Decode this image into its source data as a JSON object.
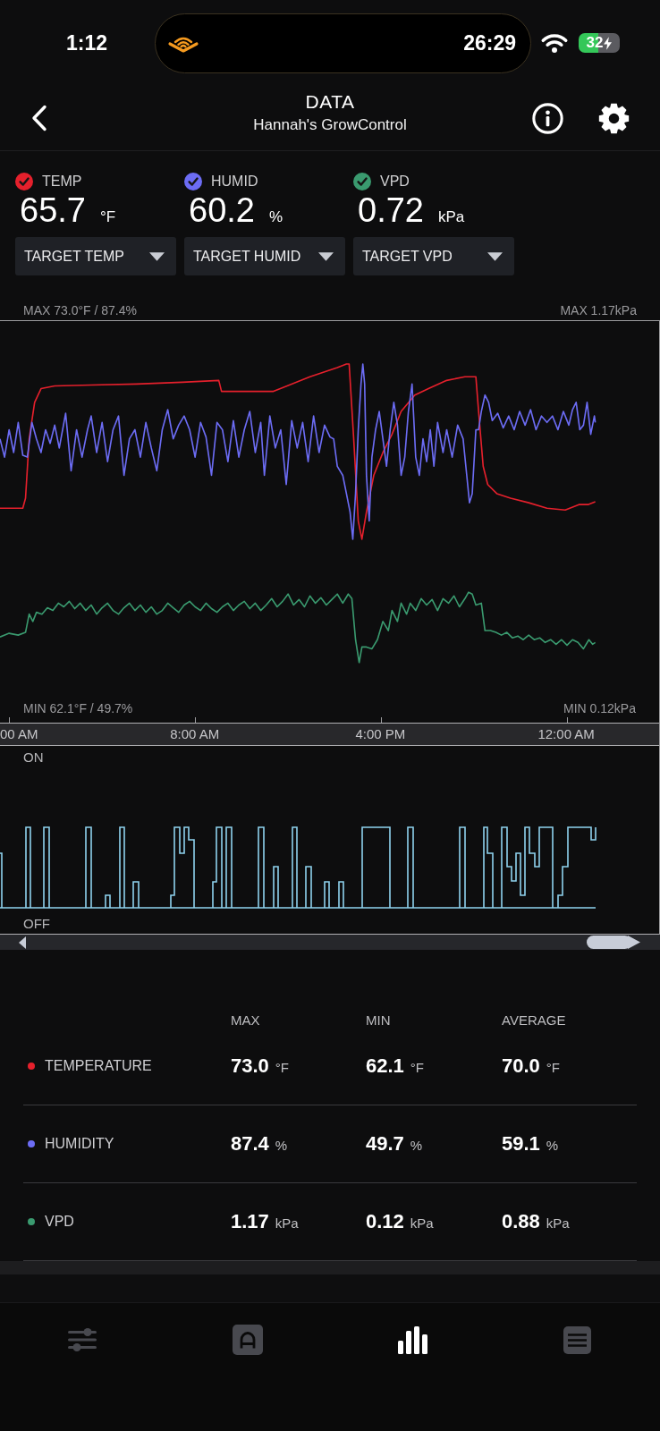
{
  "status_bar": {
    "time": "1:12",
    "timer": "26:29",
    "battery": "32"
  },
  "header": {
    "title": "DATA",
    "subtitle": "Hannah's GrowControl"
  },
  "readings": [
    {
      "label": "TEMP",
      "checked": true,
      "color": "#e5202c",
      "value": "65.7",
      "unit": "°F",
      "target": "TARGET TEMP"
    },
    {
      "label": "HUMID",
      "checked": true,
      "color": "#6c6cf4",
      "value": "60.2",
      "unit": "%",
      "target": "TARGET HUMID"
    },
    {
      "label": "VPD",
      "checked": true,
      "color": "#3a9a6f",
      "value": "0.72",
      "unit": "kPa",
      "target": "TARGET VPD"
    }
  ],
  "chart": {
    "max_left": "MAX 73.0°F / 87.4%",
    "max_right": "MAX 1.17kPa",
    "min_left": "MIN 62.1°F / 49.7%",
    "min_right": "MIN 0.12kPa",
    "time_labels": [
      "00 AM",
      "8:00 AM",
      "4:00 PM",
      "12:00 AM"
    ]
  },
  "switch_chart": {
    "top_label": "ON",
    "bottom_label": "OFF"
  },
  "stats": {
    "columns": [
      "MAX",
      "MIN",
      "AVERAGE"
    ],
    "rows": [
      {
        "name": "TEMPERATURE",
        "color": "#e5202c",
        "cells": [
          {
            "value": "73.0",
            "unit": "°F"
          },
          {
            "value": "62.1",
            "unit": "°F"
          },
          {
            "value": "70.0",
            "unit": "°F"
          }
        ]
      },
      {
        "name": "HUMIDITY",
        "color": "#6c6cf4",
        "cells": [
          {
            "value": "87.4",
            "unit": "%"
          },
          {
            "value": "49.7",
            "unit": "%"
          },
          {
            "value": "59.1",
            "unit": "%"
          }
        ]
      },
      {
        "name": "VPD",
        "color": "#3a9a6f",
        "cells": [
          {
            "value": "1.17",
            "unit": "kPa"
          },
          {
            "value": "0.12",
            "unit": "kPa"
          },
          {
            "value": "0.88",
            "unit": "kPa"
          }
        ]
      }
    ]
  },
  "tab_bar": [
    {
      "kind": "sliders",
      "selected": false
    },
    {
      "kind": "arch",
      "selected": false
    },
    {
      "kind": "bars",
      "selected": true
    },
    {
      "kind": "list",
      "selected": false
    }
  ]
}
